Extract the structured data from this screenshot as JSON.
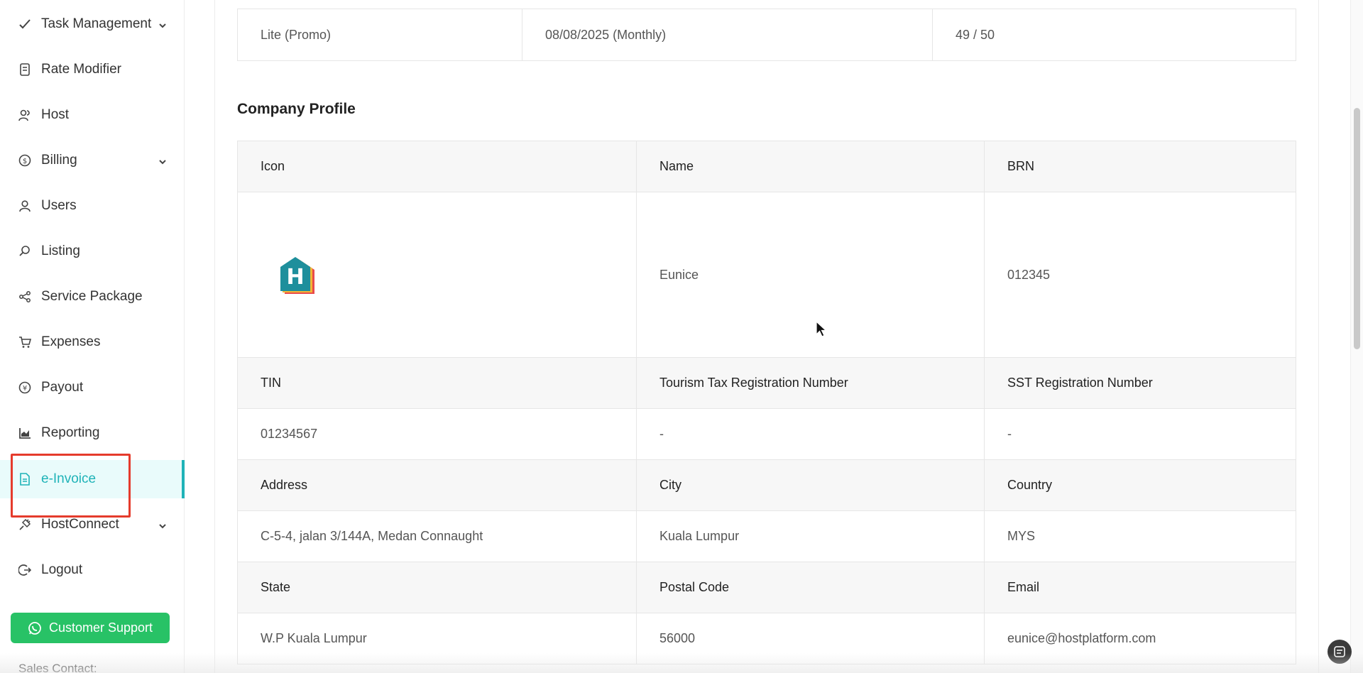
{
  "sidebar": {
    "items": [
      {
        "label": "Task Management",
        "icon": "task-icon",
        "has_chevron": true
      },
      {
        "label": "Rate Modifier",
        "icon": "rate-icon",
        "has_chevron": false
      },
      {
        "label": "Host",
        "icon": "host-icon",
        "has_chevron": false
      },
      {
        "label": "Billing",
        "icon": "billing-icon",
        "has_chevron": true
      },
      {
        "label": "Users",
        "icon": "user-icon",
        "has_chevron": false
      },
      {
        "label": "Listing",
        "icon": "search-icon",
        "has_chevron": false
      },
      {
        "label": "Service Package",
        "icon": "share-icon",
        "has_chevron": false
      },
      {
        "label": "Expenses",
        "icon": "cart-icon",
        "has_chevron": false
      },
      {
        "label": "Payout",
        "icon": "yen-icon",
        "has_chevron": false
      },
      {
        "label": "Reporting",
        "icon": "chart-icon",
        "has_chevron": false
      },
      {
        "label": "e-Invoice",
        "icon": "document-icon",
        "has_chevron": false,
        "active": true
      },
      {
        "label": "HostConnect",
        "icon": "plug-icon",
        "has_chevron": true
      },
      {
        "label": "Logout",
        "icon": "logout-icon",
        "has_chevron": false
      }
    ],
    "support_button": "Customer Support",
    "sales_contact": "Sales Contact:"
  },
  "plan": {
    "name": "Lite (Promo)",
    "date": "08/08/2025 (Monthly)",
    "usage": "49 / 50"
  },
  "company_profile": {
    "title": "Company Profile",
    "headers_row1": [
      "Icon",
      "Name",
      "BRN"
    ],
    "values_row1": {
      "icon_letter": "H",
      "name": "Eunice",
      "brn": "012345"
    },
    "headers_row2": [
      "TIN",
      "Tourism Tax Registration Number",
      "SST Registration Number"
    ],
    "values_row2": [
      "01234567",
      "-",
      "-"
    ],
    "headers_row3": [
      "Address",
      "City",
      "Country"
    ],
    "values_row3": [
      "C-5-4, jalan 3/144A, Medan Connaught",
      "Kuala Lumpur",
      "MYS"
    ],
    "headers_row4": [
      "State",
      "Postal Code",
      "Email"
    ],
    "values_row4": [
      "W.P Kuala Lumpur",
      "56000",
      "eunice@hostplatform.com"
    ]
  },
  "colors": {
    "accent": "#1fb3b8",
    "support": "#28c266",
    "highlight": "#e53b2c"
  }
}
